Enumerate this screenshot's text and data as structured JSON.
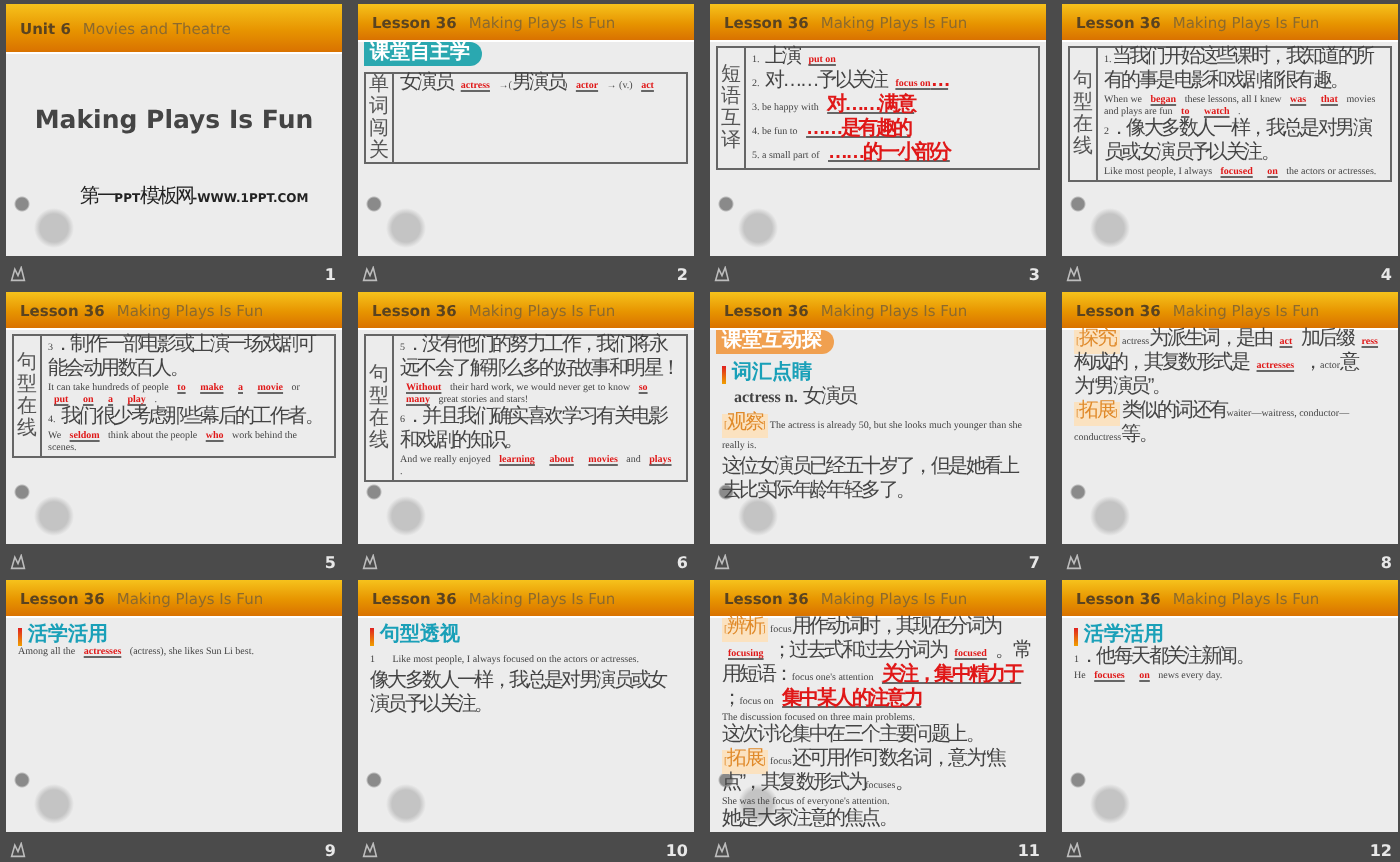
{
  "slides": [
    {
      "kind": "title",
      "header": {
        "label": "Unit 6",
        "title": "Movies and Theatre"
      },
      "title": "Making Plays Is Fun",
      "footer": "第一PPT模板网-WWW.1PPT.COM",
      "number": "1"
    },
    {
      "kind": "table",
      "header": {
        "label": "Lesson 36",
        "title": "Making Plays Is Fun"
      },
      "badge": {
        "text": "课堂自主学",
        "color": "#2aa8b0"
      },
      "side_label": "单词闯关",
      "lines": [
        {
          "kind": "text",
          "parts": [
            {
              "kind": "plain",
              "text": "女演员"
            },
            {
              "kind": "answer",
              "text": "actress"
            },
            {
              "kind": "plain",
              "text": "→(男演员)"
            },
            {
              "kind": "answer",
              "text": "actor"
            },
            {
              "kind": "plain",
              "text": "→ (v.)"
            },
            {
              "kind": "answer",
              "text": "act"
            }
          ]
        }
      ],
      "number": "2"
    },
    {
      "kind": "table",
      "header": {
        "label": "Lesson 36",
        "title": "Making Plays Is Fun"
      },
      "side_label": "短语互译",
      "lines": [
        {
          "kind": "text",
          "parts": [
            {
              "kind": "plain",
              "text": "1. 上演"
            },
            {
              "kind": "answer",
              "text": "put on"
            }
          ]
        },
        {
          "kind": "text",
          "parts": [
            {
              "kind": "plain",
              "text": "2. 对……予以关注"
            },
            {
              "kind": "answer",
              "text": "focus on…"
            }
          ]
        },
        {
          "kind": "text",
          "parts": [
            {
              "kind": "plain",
              "text": "3. be happy with"
            },
            {
              "kind": "answer",
              "text": "对……满意"
            }
          ]
        },
        {
          "kind": "text",
          "parts": [
            {
              "kind": "plain",
              "text": "4. be fun to"
            },
            {
              "kind": "answer",
              "text": "……是有趣的"
            }
          ]
        },
        {
          "kind": "text",
          "parts": [
            {
              "kind": "plain",
              "text": "5. a small part of"
            },
            {
              "kind": "answer",
              "text": "……的一小部分"
            }
          ]
        }
      ],
      "number": "3"
    },
    {
      "kind": "table",
      "header": {
        "label": "Lesson 36",
        "title": "Making Plays Is Fun"
      },
      "side_label": "句型在线",
      "lines": [
        {
          "kind": "text",
          "parts": [
            {
              "kind": "plain",
              "text": "1.当我们开始这些课时，我知道的所有的事是电影和戏剧都很有趣。"
            }
          ]
        },
        {
          "kind": "text",
          "parts": [
            {
              "kind": "plain",
              "text": "When we"
            },
            {
              "kind": "answer",
              "text": "began"
            },
            {
              "kind": "plain",
              "text": "these lessons, all I knew"
            },
            {
              "kind": "answer",
              "text": "was"
            },
            {
              "kind": "answer",
              "text": "that"
            },
            {
              "kind": "plain",
              "text": "movies and plays are fun"
            },
            {
              "kind": "answer",
              "text": "to"
            },
            {
              "kind": "answer",
              "text": "watch"
            },
            {
              "kind": "plain",
              "text": "."
            }
          ]
        },
        {
          "kind": "text",
          "parts": [
            {
              "kind": "plain",
              "text": "2．像大多数人一样，我总是对男演员或女演员予以关注。"
            }
          ]
        },
        {
          "kind": "text",
          "parts": [
            {
              "kind": "plain",
              "text": "Like most people, I always"
            },
            {
              "kind": "answer",
              "text": "focused"
            },
            {
              "kind": "answer",
              "text": "on"
            },
            {
              "kind": "plain",
              "text": "the actors or actresses."
            }
          ]
        }
      ],
      "number": "4"
    },
    {
      "kind": "table",
      "header": {
        "label": "Lesson 36",
        "title": "Making Plays Is Fun"
      },
      "side_label": "句型在线",
      "lines": [
        {
          "kind": "text",
          "parts": [
            {
              "kind": "plain",
              "text": "3．制作一部电影或上演一场戏剧可能会动用数百人。"
            }
          ]
        },
        {
          "kind": "text",
          "parts": [
            {
              "kind": "plain",
              "text": "It can take hundreds of people"
            },
            {
              "kind": "answer",
              "text": "to"
            },
            {
              "kind": "answer",
              "text": "make"
            },
            {
              "kind": "answer",
              "text": "a"
            },
            {
              "kind": "answer",
              "text": "movie"
            },
            {
              "kind": "plain",
              "text": "or"
            },
            {
              "kind": "answer",
              "text": "put"
            },
            {
              "kind": "answer",
              "text": "on"
            },
            {
              "kind": "answer",
              "text": "a"
            },
            {
              "kind": "answer",
              "text": "play"
            },
            {
              "kind": "plain",
              "text": "."
            }
          ]
        },
        {
          "kind": "text",
          "parts": [
            {
              "kind": "plain",
              "text": "4. 我们很少考虑那些幕后的工作者。"
            }
          ]
        },
        {
          "kind": "text",
          "parts": [
            {
              "kind": "plain",
              "text": "We"
            },
            {
              "kind": "answer",
              "text": "seldom"
            },
            {
              "kind": "plain",
              "text": "think about the people"
            },
            {
              "kind": "answer",
              "text": "who"
            },
            {
              "kind": "plain",
              "text": "work behind the scenes."
            }
          ]
        }
      ],
      "number": "5"
    },
    {
      "kind": "table",
      "header": {
        "label": "Lesson 36",
        "title": "Making Plays Is Fun"
      },
      "side_label": "句型在线",
      "lines": [
        {
          "kind": "text",
          "parts": [
            {
              "kind": "plain",
              "text": "5．没有他们的努力工作，我们将永远不会了解那么多的好故事和明星！"
            }
          ]
        },
        {
          "kind": "text",
          "parts": [
            {
              "kind": "answer",
              "text": "Without"
            },
            {
              "kind": "plain",
              "text": "their hard work, we would never get to know"
            },
            {
              "kind": "answer",
              "text": "so"
            },
            {
              "kind": "answer",
              "text": "many"
            },
            {
              "kind": "plain",
              "text": "great stories and stars!"
            }
          ]
        },
        {
          "kind": "text",
          "parts": [
            {
              "kind": "plain",
              "text": "6．并且我们确实喜欢学习有关电影和戏剧的知识。"
            }
          ]
        },
        {
          "kind": "text",
          "parts": [
            {
              "kind": "plain",
              "text": "And we really enjoyed"
            },
            {
              "kind": "answer",
              "text": "learning"
            },
            {
              "kind": "answer",
              "text": "about"
            },
            {
              "kind": "answer",
              "text": "movies"
            },
            {
              "kind": "plain",
              "text": "and"
            },
            {
              "kind": "answer",
              "text": "plays"
            },
            {
              "kind": "plain",
              "text": "."
            }
          ]
        }
      ],
      "number": "6"
    },
    {
      "kind": "text",
      "header": {
        "label": "Lesson 36",
        "title": "Making Plays Is Fun"
      },
      "badge": {
        "text": "课堂互动探",
        "color": "#f0a050"
      },
      "lines": [
        {
          "kind": "section",
          "parts": [
            {
              "kind": "plain",
              "text": "词汇点睛"
            }
          ]
        },
        {
          "kind": "term",
          "parts": [
            {
              "kind": "plain",
              "text": "actress n. 女演员"
            }
          ]
        },
        {
          "kind": "text",
          "parts": [
            {
              "kind": "tag",
              "text": "[观察]"
            },
            {
              "kind": "plain",
              "text": "The actress is already 50, but she looks much younger than she really is."
            }
          ]
        },
        {
          "kind": "text",
          "parts": [
            {
              "kind": "plain",
              "text": "这位女演员已经五十岁了，但是她看上去比实际年龄年轻多了。"
            }
          ]
        }
      ],
      "number": "7"
    },
    {
      "kind": "text",
      "header": {
        "label": "Lesson 36",
        "title": "Making Plays Is Fun"
      },
      "lines": [
        {
          "kind": "text",
          "parts": [
            {
              "kind": "tag",
              "text": "[探究]"
            },
            {
              "kind": "plain",
              "text": "actress为派生词，是由"
            },
            {
              "kind": "answer",
              "text": "act"
            },
            {
              "kind": "plain",
              "text": "加后缀"
            },
            {
              "kind": "answer",
              "text": "ress"
            },
            {
              "kind": "plain",
              "text": "构成的，其复数形式是"
            },
            {
              "kind": "answer",
              "text": "actresses"
            },
            {
              "kind": "plain",
              "text": "，actor意为“男演员”。"
            }
          ]
        },
        {
          "kind": "text",
          "parts": [
            {
              "kind": "tag",
              "text": "[拓展]"
            },
            {
              "kind": "plain",
              "text": "类似的词还有waiter—waitress, conductor—conductress等。"
            }
          ]
        }
      ],
      "number": "8"
    },
    {
      "kind": "text",
      "header": {
        "label": "Lesson 36",
        "title": "Making Plays Is Fun"
      },
      "lines": [
        {
          "kind": "section",
          "parts": [
            {
              "kind": "plain",
              "text": "活学活用"
            }
          ]
        },
        {
          "kind": "text",
          "parts": [
            {
              "kind": "plain",
              "text": "Among all the"
            },
            {
              "kind": "answer",
              "text": "actresses"
            },
            {
              "kind": "plain",
              "text": "(actress), she likes Sun Li best."
            }
          ]
        }
      ],
      "number": "9"
    },
    {
      "kind": "text",
      "header": {
        "label": "Lesson 36",
        "title": "Making Plays Is Fun"
      },
      "lines": [
        {
          "kind": "section",
          "parts": [
            {
              "kind": "plain",
              "text": "句型透视"
            }
          ]
        },
        {
          "kind": "text",
          "parts": [
            {
              "kind": "plain",
              "text": "1　Like most people, I always focused on the actors or actresses."
            }
          ]
        },
        {
          "kind": "text",
          "parts": [
            {
              "kind": "plain",
              "text": "像大多数人一样，我总是对男演员或女演员予以关注。"
            }
          ]
        }
      ],
      "number": "10"
    },
    {
      "kind": "text",
      "header": {
        "label": "Lesson 36",
        "title": "Making Plays Is Fun"
      },
      "lines": [
        {
          "kind": "text",
          "parts": [
            {
              "kind": "tag",
              "text": "[辨析]"
            },
            {
              "kind": "plain",
              "text": "focus用作动词时，其现在分词为"
            },
            {
              "kind": "answer",
              "text": "focusing"
            },
            {
              "kind": "plain",
              "text": "；过去式和过去分词为"
            },
            {
              "kind": "answer",
              "text": "focused"
            },
            {
              "kind": "plain",
              "text": "。常用短语：focus one's attention"
            },
            {
              "kind": "answer",
              "text": "关注，集中精力于"
            },
            {
              "kind": "plain",
              "text": "；focus on"
            },
            {
              "kind": "answer",
              "text": "集中某人的注意力"
            }
          ]
        },
        {
          "kind": "text",
          "parts": [
            {
              "kind": "plain",
              "text": "The discussion focused on three main problems."
            }
          ]
        },
        {
          "kind": "text",
          "parts": [
            {
              "kind": "plain",
              "text": "这次讨论集中在三个主要问题上。"
            }
          ]
        },
        {
          "kind": "text",
          "parts": [
            {
              "kind": "tag",
              "text": "[拓展]"
            },
            {
              "kind": "plain",
              "text": "focus还可用作可数名词，意为“焦点”，其复数形式为focuses。"
            }
          ]
        },
        {
          "kind": "text",
          "parts": [
            {
              "kind": "plain",
              "text": "She was the focus of everyone's attention."
            }
          ]
        },
        {
          "kind": "text",
          "parts": [
            {
              "kind": "plain",
              "text": "她是大家注意的焦点。"
            }
          ]
        }
      ],
      "number": "11"
    },
    {
      "kind": "text",
      "header": {
        "label": "Lesson 36",
        "title": "Making Plays Is Fun"
      },
      "lines": [
        {
          "kind": "section",
          "parts": [
            {
              "kind": "plain",
              "text": "活学活用"
            }
          ]
        },
        {
          "kind": "text",
          "parts": [
            {
              "kind": "plain",
              "text": "1．他每天都关注新闻。"
            }
          ]
        },
        {
          "kind": "text",
          "parts": [
            {
              "kind": "plain",
              "text": "He"
            },
            {
              "kind": "answer",
              "text": "focuses"
            },
            {
              "kind": "answer",
              "text": "on"
            },
            {
              "kind": "plain",
              "text": "news every day."
            }
          ]
        }
      ],
      "number": "12"
    }
  ]
}
